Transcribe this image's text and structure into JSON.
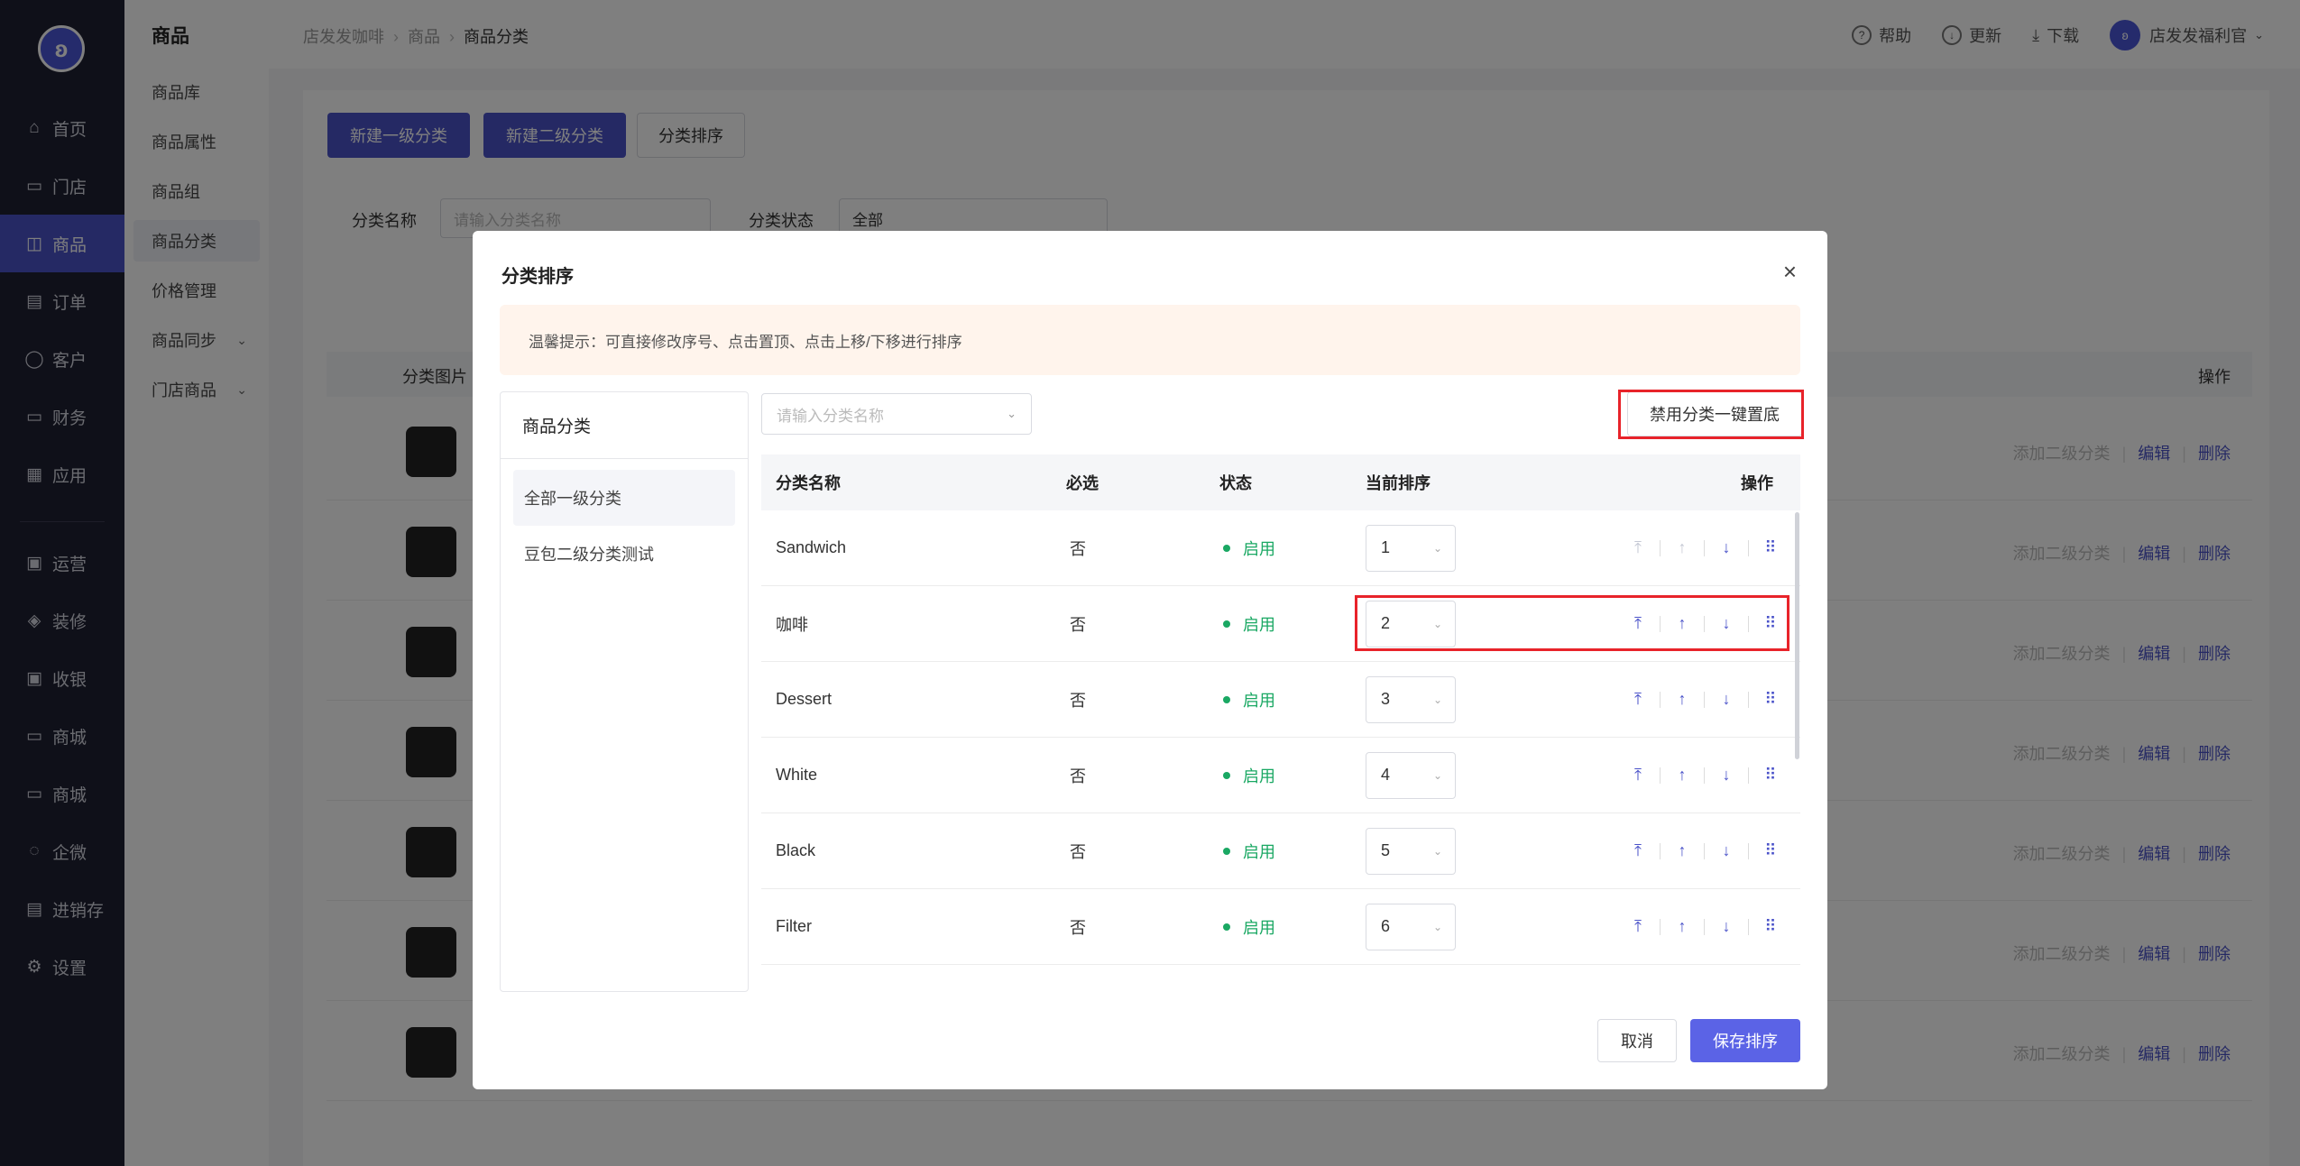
{
  "nav": {
    "items": [
      {
        "label": "首页",
        "icon": "home-icon"
      },
      {
        "label": "门店",
        "icon": "store-icon"
      },
      {
        "label": "商品",
        "icon": "bag-icon"
      },
      {
        "label": "订单",
        "icon": "order-icon"
      },
      {
        "label": "客户",
        "icon": "user-icon"
      },
      {
        "label": "财务",
        "icon": "wallet-icon"
      },
      {
        "label": "应用",
        "icon": "grid-icon"
      },
      {
        "label": "运营",
        "icon": "gift-icon"
      },
      {
        "label": "装修",
        "icon": "layers-icon"
      },
      {
        "label": "收银",
        "icon": "cashier-icon"
      },
      {
        "label": "商城",
        "icon": "shop-icon"
      },
      {
        "label": "商城",
        "icon": "shop-icon"
      },
      {
        "label": "企微",
        "icon": "chat-icon"
      },
      {
        "label": "进销存",
        "icon": "inventory-icon"
      },
      {
        "label": "设置",
        "icon": "gear-icon"
      }
    ]
  },
  "subnav": {
    "title": "商品",
    "items": [
      {
        "label": "商品库"
      },
      {
        "label": "商品属性"
      },
      {
        "label": "商品组"
      },
      {
        "label": "商品分类"
      },
      {
        "label": "价格管理"
      },
      {
        "label": "商品同步"
      },
      {
        "label": "门店商品"
      }
    ]
  },
  "header": {
    "breadcrumb": [
      "店发发咖啡",
      "商品",
      "商品分类"
    ],
    "help": "帮助",
    "update": "更新",
    "download": "下载",
    "user": "店发发福利官"
  },
  "page": {
    "btn_new_level1": "新建一级分类",
    "btn_new_level2": "新建二级分类",
    "btn_sort": "分类排序",
    "filter_name_label": "分类名称",
    "filter_name_placeholder": "请输入分类名称",
    "filter_status_label": "分类状态",
    "filter_status_value": "全部",
    "col_image": "分类图片",
    "col_ops": "操作",
    "row_ops": {
      "add": "添加二级分类",
      "edit": "编辑",
      "delete": "删除"
    }
  },
  "modal": {
    "title": "分类排序",
    "tip": "温馨提示：可直接修改序号、点击置顶、点击上移/下移进行排序",
    "left_panel_title": "商品分类",
    "categories": [
      {
        "label": "全部一级分类"
      },
      {
        "label": "豆包二级分类测试"
      }
    ],
    "search_placeholder": "请输入分类名称",
    "bottom_button": "禁用分类一键置底",
    "columns": {
      "name": "分类名称",
      "required": "必选",
      "status": "状态",
      "order": "当前排序",
      "ops": "操作"
    },
    "rows": [
      {
        "name": "Sandwich",
        "required": "否",
        "status": "启用",
        "order": "1"
      },
      {
        "name": "咖啡",
        "required": "否",
        "status": "启用",
        "order": "2"
      },
      {
        "name": "Dessert",
        "required": "否",
        "status": "启用",
        "order": "3"
      },
      {
        "name": "White",
        "required": "否",
        "status": "启用",
        "order": "4"
      },
      {
        "name": "Black",
        "required": "否",
        "status": "启用",
        "order": "5"
      },
      {
        "name": "Filter",
        "required": "否",
        "status": "启用",
        "order": "6"
      }
    ],
    "cancel": "取消",
    "save": "保存排序"
  },
  "colors": {
    "primary": "#4a52c9",
    "nav_bg": "#1f2033",
    "success": "#1aa863",
    "highlight": "#e8232a"
  }
}
